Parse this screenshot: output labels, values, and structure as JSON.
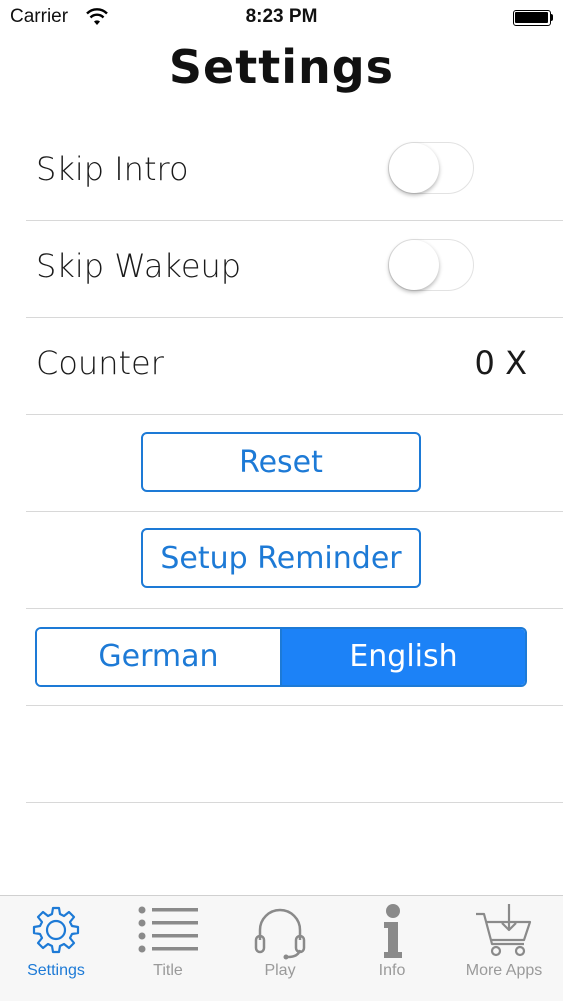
{
  "status_bar": {
    "carrier": "Carrier",
    "time": "8:23 PM"
  },
  "page": {
    "title": "Settings"
  },
  "settings": {
    "skip_intro": {
      "label": "Skip Intro",
      "on": false
    },
    "skip_wakeup": {
      "label": "Skip Wakeup",
      "on": false
    },
    "counter": {
      "label": "Counter",
      "value": "0 X"
    }
  },
  "buttons": {
    "reset": "Reset",
    "setup_reminder": "Setup Reminder"
  },
  "language": {
    "options": [
      "German",
      "English"
    ],
    "selected": "English"
  },
  "colors": {
    "accent": "#1d7ad6",
    "selected_segment": "#1c82f7",
    "inactive_tab": "#9a9a9a"
  },
  "tab_bar": {
    "items": [
      {
        "label": "Settings",
        "icon": "gear-icon",
        "active": true
      },
      {
        "label": "Title",
        "icon": "list-icon",
        "active": false
      },
      {
        "label": "Play",
        "icon": "headphones-icon",
        "active": false
      },
      {
        "label": "Info",
        "icon": "info-icon",
        "active": false
      },
      {
        "label": "More Apps",
        "icon": "cart-icon",
        "active": false
      }
    ]
  }
}
